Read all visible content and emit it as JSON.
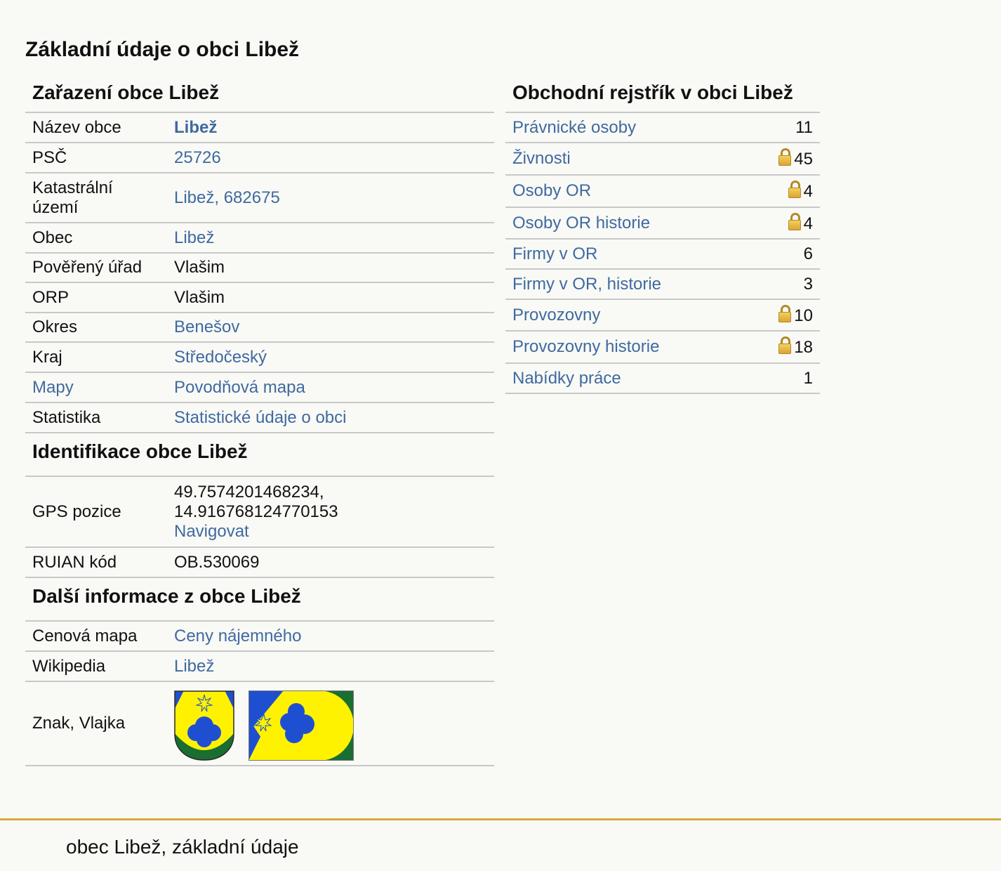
{
  "page_title": "Základní údaje o obci Libež",
  "zarazeni": {
    "heading": "Zařazení obce Libež",
    "rows": [
      {
        "label": "Název obce",
        "value": "Libež"
      },
      {
        "label": "PSČ",
        "value": "25726"
      },
      {
        "label": "Katastrální území",
        "value": "Libež, 682675"
      },
      {
        "label": "Obec",
        "value": "Libež"
      },
      {
        "label": "Pověřený úřad",
        "value": "Vlašim"
      },
      {
        "label": "ORP",
        "value": "Vlašim"
      },
      {
        "label": "Okres",
        "value": "Benešov"
      },
      {
        "label": "Kraj",
        "value": "Středočeský"
      },
      {
        "label": "Mapy",
        "value": "Povodňová mapa"
      },
      {
        "label": "Statistika",
        "value": "Statistické údaje o obci"
      }
    ]
  },
  "identifikace": {
    "heading": "Identifikace obce Libež",
    "gps_label": "GPS pozice",
    "gps_lat": "49.7574201468234,",
    "gps_lon": "14.916768124770153",
    "gps_link": "Navigovat",
    "ruian_label": "RUIAN kód",
    "ruian_value": "OB.530069"
  },
  "dalsi": {
    "heading": "Další informace z obce Libež",
    "cenova_label": "Cenová mapa",
    "cenova_value": "Ceny nájemného",
    "wiki_label": "Wikipedia",
    "wiki_value": "Libež",
    "znak_label": "Znak, Vlajka"
  },
  "rejstrik": {
    "heading": "Obchodní rejstřík v obci Libež",
    "rows": [
      {
        "label": "Právnické osoby",
        "count": "11",
        "locked": false
      },
      {
        "label": "Živnosti",
        "count": "45",
        "locked": true
      },
      {
        "label": "Osoby OR",
        "count": "4",
        "locked": true
      },
      {
        "label": "Osoby OR historie",
        "count": "4",
        "locked": true
      },
      {
        "label": "Firmy v OR",
        "count": "6",
        "locked": false
      },
      {
        "label": "Firmy v OR, historie",
        "count": "3",
        "locked": false
      },
      {
        "label": "Provozovny",
        "count": "10",
        "locked": true
      },
      {
        "label": "Provozovny historie",
        "count": "18",
        "locked": true
      },
      {
        "label": "Nabídky práce",
        "count": "1",
        "locked": false
      }
    ]
  },
  "footer": {
    "text": "obec Libež, základní údaje"
  },
  "colors": {
    "link": "#3f6aa0",
    "accent": "#d4ac3a",
    "flag_blue": "#1f4fd1",
    "flag_yellow": "#fff200",
    "flag_green": "#1a6e32"
  },
  "icons": {
    "lock": "lock-icon",
    "coat_of_arms": "coat-of-arms-image",
    "flag": "flag-image"
  }
}
